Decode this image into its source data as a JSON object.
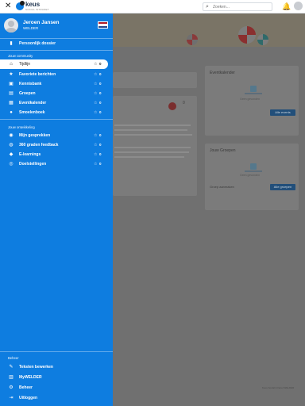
{
  "topbar": {
    "logo_text": "keus",
    "logo_subtitle": "SOCIAL INTRANET",
    "search_placeholder": "Zoeken..."
  },
  "profile": {
    "name": "Jeroen Jansen",
    "org": "WELDER"
  },
  "nav_top": [
    {
      "label": "Persoonlijk dossier",
      "icon": "folder-icon"
    }
  ],
  "community": {
    "title": "Jouw community",
    "items": [
      {
        "label": "Tijdlijn",
        "icon": "home-icon",
        "count": "0",
        "active": true
      },
      {
        "label": "Favoriete berichten",
        "icon": "star-icon",
        "count": "0"
      },
      {
        "label": "Kennisbank",
        "icon": "book-icon",
        "count": "0"
      },
      {
        "label": "Groepen",
        "icon": "group-icon",
        "count": "0"
      },
      {
        "label": "Eventkalender",
        "icon": "calendar-icon",
        "count": "0"
      },
      {
        "label": "Smoelenboek",
        "icon": "person-icon",
        "count": "0"
      }
    ]
  },
  "development": {
    "title": "Jouw ontwikkeling",
    "items": [
      {
        "label": "Mijn gesprekken",
        "icon": "chat-icon",
        "count": "0"
      },
      {
        "label": "360 graden feedback",
        "icon": "feedback-icon",
        "count": "0"
      },
      {
        "label": "E-learnings",
        "icon": "elearning-icon",
        "count": "0"
      },
      {
        "label": "Doelstellingen",
        "icon": "target-icon",
        "count": "0"
      }
    ]
  },
  "beheer": {
    "title": "Beheer",
    "items": [
      {
        "label": "Teksten bewerken",
        "icon": "edit-text-icon"
      },
      {
        "label": "MyWELDER",
        "icon": "company-icon"
      },
      {
        "label": "Beheer",
        "icon": "gear-icon"
      },
      {
        "label": "Uitloggen",
        "icon": "logout-icon"
      }
    ]
  },
  "background": {
    "post_count": "0",
    "events_title": "Eventkalender",
    "events_empty": "Geen gevonden",
    "events_btn": "Alle events",
    "groups_title": "Jouw Groepen",
    "groups_empty": "Geen gevonden",
    "groups_link": "Groep aanmaken",
    "groups_btn": "Alle groepen",
    "footer": "Keus Social intranet WELDER"
  },
  "colors": {
    "sidebar": "#0e7de0",
    "overlay": "#707070"
  }
}
